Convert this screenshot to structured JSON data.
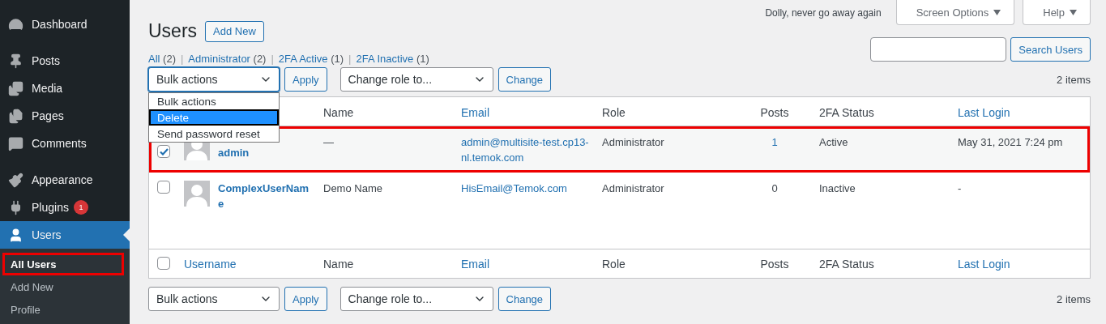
{
  "sidebar": {
    "sections": [
      [
        {
          "label": "Dashboard",
          "selected": false
        }
      ],
      [
        {
          "label": "Posts",
          "selected": false
        },
        {
          "label": "Media",
          "selected": false
        },
        {
          "label": "Pages",
          "selected": false
        },
        {
          "label": "Comments",
          "selected": false
        }
      ],
      [
        {
          "label": "Appearance",
          "selected": false
        },
        {
          "label": "Plugins",
          "selected": false,
          "badge": "1"
        },
        {
          "label": "Users",
          "selected": true,
          "children": [
            {
              "label": "All Users",
              "selected": true,
              "highlighted": true
            },
            {
              "label": "Add New",
              "selected": false,
              "highlighted": false
            },
            {
              "label": "Profile",
              "selected": false,
              "highlighted": false
            }
          ]
        }
      ]
    ]
  },
  "top_bar": {
    "note": "Dolly, never go away again",
    "buttons": [
      "Screen Options",
      "Help"
    ]
  },
  "page": {
    "title": "Users",
    "add_new": "Add New"
  },
  "filters": [
    {
      "label": "All",
      "count": "(2)",
      "selected": false
    },
    {
      "label": "Administrator",
      "count": "(2)",
      "selected": false
    },
    {
      "label": "2FA Active",
      "count": "(1)",
      "selected": false
    },
    {
      "label": "2FA Inactive",
      "count": "(1)",
      "selected": false
    }
  ],
  "filter_separator": "|",
  "search": {
    "button": "Search Users"
  },
  "top_actions": {
    "bulk": "Bulk actions",
    "bulk_open": true,
    "apply": "Apply",
    "role": "Change role to...",
    "change": "Change",
    "count": "2 items"
  },
  "bulk_menu": [
    {
      "label": "Bulk actions",
      "selected": false
    },
    {
      "label": "Delete",
      "selected": true
    },
    {
      "label": "Send password reset",
      "selected": false
    }
  ],
  "table": {
    "header": [
      {
        "label": "Name",
        "link": false
      },
      {
        "label": "Email",
        "link": true
      },
      {
        "label": "Role",
        "link": false
      },
      {
        "label": "Posts",
        "link": false
      },
      {
        "label": "2FA Status",
        "link": false
      },
      {
        "label": "Last Login",
        "link": true
      }
    ],
    "rows": [
      {
        "checked": true,
        "highlighted": true,
        "username": "admin",
        "name": "—",
        "email": "admin@multisite-test.cp13-nl.temok.com",
        "role": "Administrator",
        "posts": "1",
        "posts_link": true,
        "status": "Active",
        "last_login": "May 31, 2021 7:24 pm"
      },
      {
        "checked": false,
        "highlighted": false,
        "username": "ComplexUserName",
        "name": "Demo Name",
        "email": "HisEmail@Temok.com",
        "role": "Administrator",
        "posts": "0",
        "posts_link": false,
        "status": "Inactive",
        "last_login": "-"
      }
    ],
    "footer_checked": false,
    "footer": [
      {
        "label": "Username",
        "link": true
      },
      {
        "label": "Name",
        "link": false
      },
      {
        "label": "Email",
        "link": true
      },
      {
        "label": "Role",
        "link": false
      },
      {
        "label": "Posts",
        "link": false
      },
      {
        "label": "2FA Status",
        "link": false
      },
      {
        "label": "Last Login",
        "link": true
      }
    ]
  },
  "bottom_actions": {
    "bulk": "Bulk actions",
    "apply": "Apply",
    "role": "Change role to...",
    "change": "Change",
    "count": "2 items"
  }
}
